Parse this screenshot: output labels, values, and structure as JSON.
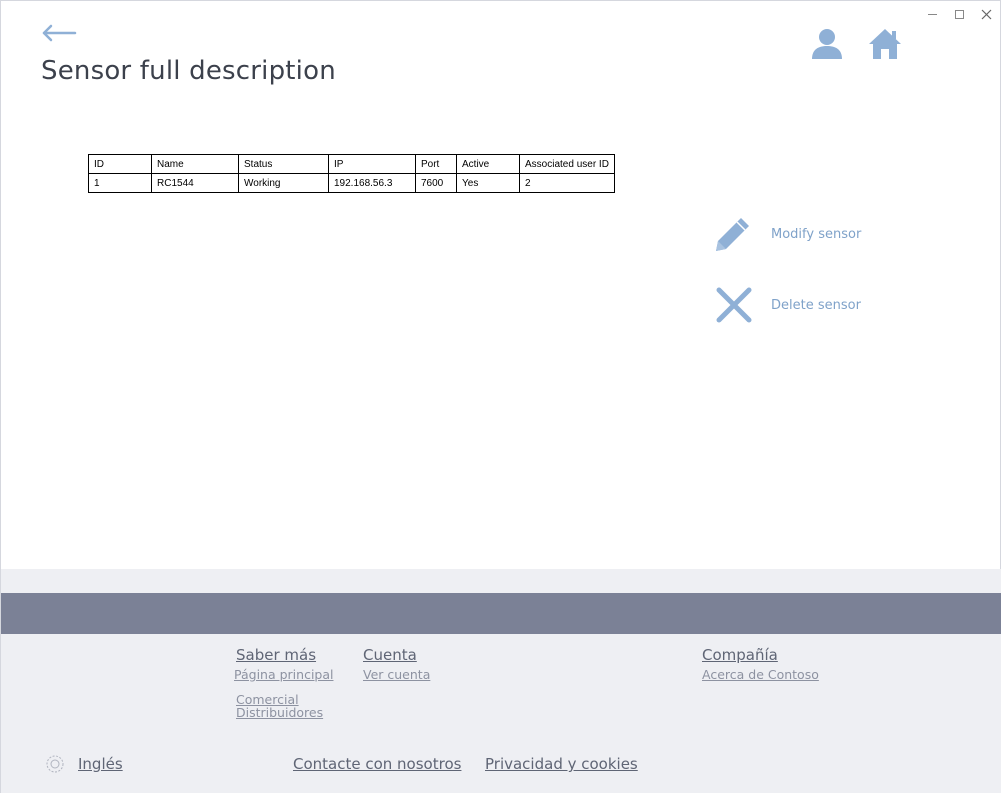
{
  "page": {
    "title": "Sensor full description"
  },
  "table": {
    "headers": [
      "ID",
      "Name",
      "Status",
      "IP",
      "Port",
      "Active",
      "Associated user ID"
    ],
    "rows": [
      [
        "1",
        "RC1544",
        "Working",
        "192.168.56.3",
        "7600",
        "Yes",
        "2"
      ]
    ]
  },
  "actions": {
    "modify_label": "Modify sensor",
    "delete_label": "Delete sensor"
  },
  "footer": {
    "col1": {
      "heading": "Saber más",
      "links": [
        "Página principal",
        "Comercial",
        "Distribuidores"
      ]
    },
    "col2": {
      "heading": "Cuenta",
      "links": [
        "Ver cuenta"
      ]
    },
    "col3": {
      "heading": "Compañía",
      "links": [
        "Acerca de Contoso"
      ]
    },
    "language": "Inglés",
    "contact": "Contacte con nosotros",
    "privacy": "Privacidad y cookies"
  },
  "colors": {
    "accent": "#7fa2c9",
    "icon_blue": "#8fb0d6",
    "footer_band": "#7b8196",
    "footer_bg": "#eeeff3"
  },
  "icons": {
    "back": "arrow-left-icon",
    "user": "user-icon",
    "home": "home-icon",
    "modify": "pencil-icon",
    "delete": "close-x-icon",
    "language": "globe-icon"
  }
}
